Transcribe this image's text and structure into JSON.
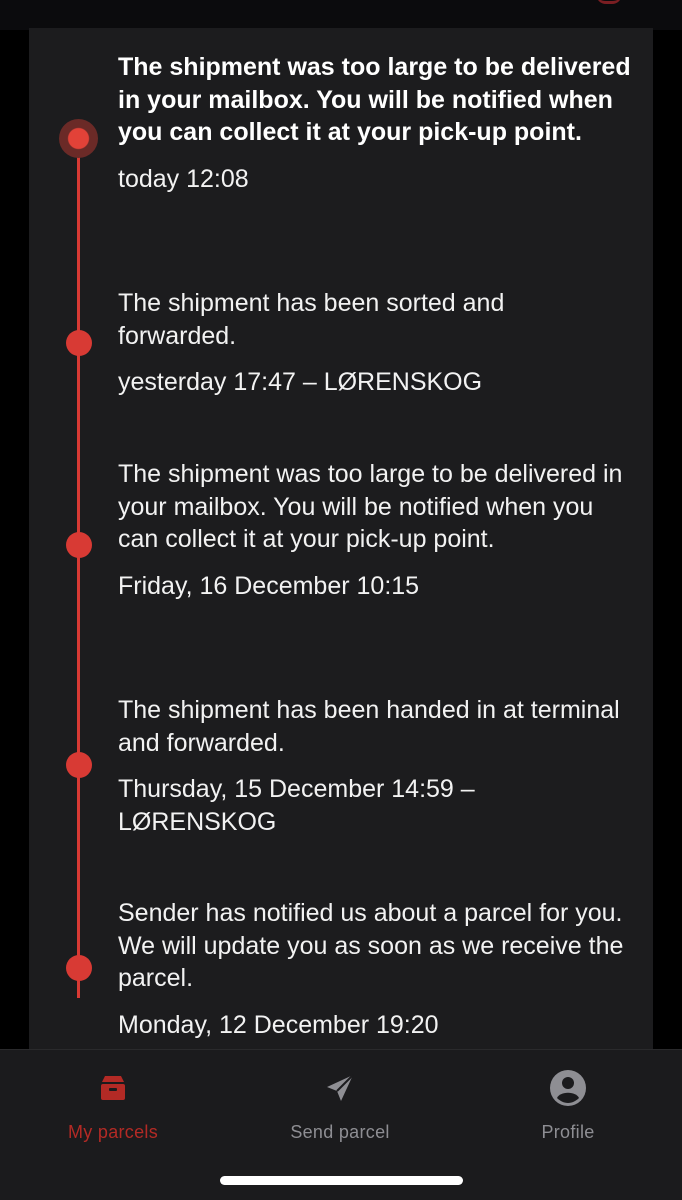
{
  "timeline": {
    "events": [
      {
        "description": "The shipment was too large to be delivered in your mailbox. You will be notified when you can collect it at your pick-up point.",
        "meta": "today 12:08",
        "current": true
      },
      {
        "description": "The shipment has been sorted and forwarded.",
        "meta": "yesterday 17:47 – LØRENSKOG",
        "current": false
      },
      {
        "description": "The shipment was too large to be delivered in your mailbox. You will be notified when you can collect it at your pick-up point.",
        "meta": "Friday, 16 December 10:15",
        "current": false
      },
      {
        "description": "The shipment has been handed in at terminal and forwarded.",
        "meta": "Thursday, 15 December 14:59 – LØRENSKOG",
        "current": false
      },
      {
        "description": "Sender has notified us about a parcel for you. We will update you as soon as we receive the parcel.",
        "meta": "Monday, 12 December 19:20",
        "current": false
      }
    ]
  },
  "tabbar": {
    "tabs": [
      {
        "label": "My parcels",
        "icon": "parcel-icon",
        "active": true
      },
      {
        "label": "Send parcel",
        "icon": "paper-plane-icon",
        "active": false
      },
      {
        "label": "Profile",
        "icon": "profile-icon",
        "active": false
      }
    ]
  },
  "colors": {
    "accent": "#d83a34",
    "active_tab": "#b32a25",
    "inactive_tab": "#8e8e93",
    "card_background": "#1c1c1e"
  }
}
